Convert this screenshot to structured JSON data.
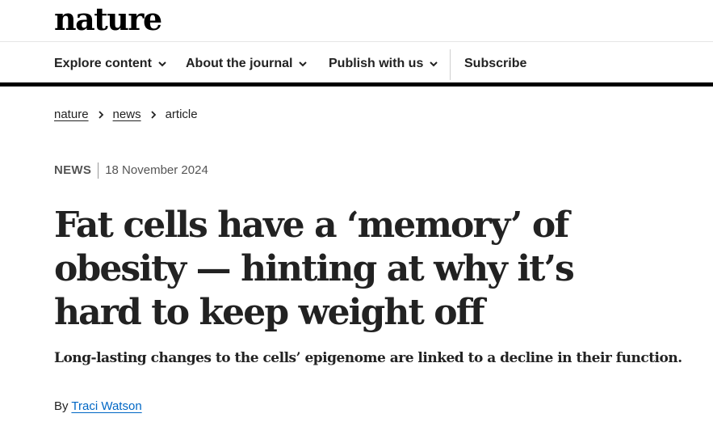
{
  "site": {
    "logo": "nature"
  },
  "nav": {
    "items": [
      {
        "label": "Explore content",
        "has_dropdown": true
      },
      {
        "label": "About the journal",
        "has_dropdown": true
      },
      {
        "label": "Publish with us",
        "has_dropdown": true
      },
      {
        "label": "Subscribe",
        "has_dropdown": false
      }
    ]
  },
  "breadcrumb": {
    "items": [
      {
        "label": "nature",
        "link": true
      },
      {
        "label": "news",
        "link": true
      },
      {
        "label": "article",
        "link": false
      }
    ]
  },
  "article": {
    "type": "NEWS",
    "date": "18 November 2024",
    "title": "Fat cells have a ‘memory’ of obesity — hinting at why it’s hard to keep weight off",
    "standfirst": "Long-lasting changes to the cells’ epigenome are linked to a decline in their function.",
    "byline_prefix": "By",
    "author": "Traci Watson"
  },
  "colors": {
    "text": "#222222",
    "link_blue": "#0067c5",
    "rule": "#000000"
  },
  "icons": {
    "dropdown": "chevron-down-icon",
    "breadcrumb_separator": "chevron-right-icon"
  }
}
